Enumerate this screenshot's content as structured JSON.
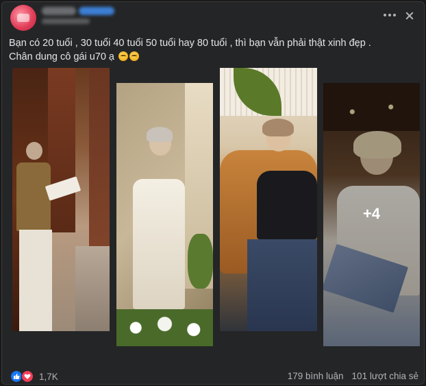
{
  "post": {
    "text_line1": "Bạn có 20 tuổi , 30 tuổi 40 tuổi 50 tuổi hay 80 tuổi , thì bạn vẫn phải thật xinh đẹp .",
    "text_line2": "Chân dung cô gái u70 ạ",
    "emoji": "grinning-face-icon"
  },
  "photos": {
    "more_count": "+4"
  },
  "footer": {
    "reaction_count": "1,7K",
    "comments": "179 bình luận",
    "shares": "101 lượt chia sẻ"
  },
  "colors": {
    "card_bg": "#242526",
    "text": "#e4e6eb",
    "muted": "#b0b3b8",
    "like": "#1877f2",
    "love": "#f33e58"
  }
}
